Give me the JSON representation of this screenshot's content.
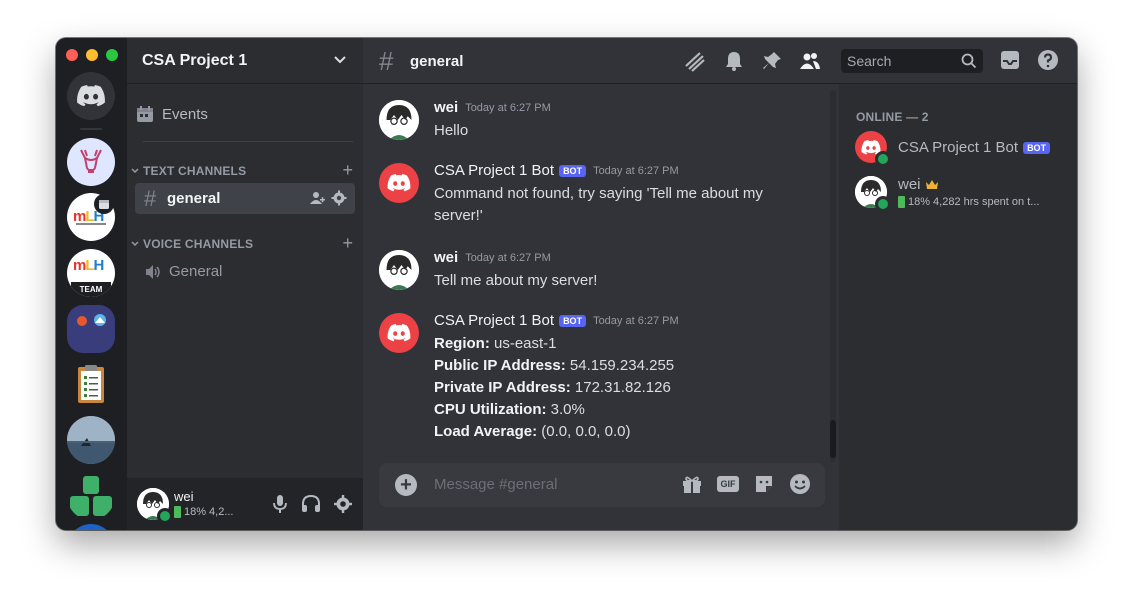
{
  "server": {
    "name": "CSA Project 1"
  },
  "rail": {
    "home_icon": "discord-logo-icon",
    "servers": [
      {
        "name": "deer-server",
        "icon": "deer-icon"
      },
      {
        "name": "mlh-server",
        "text": "MLH"
      },
      {
        "name": "mlh-team-server",
        "text": "MLH",
        "sub": "TEAM"
      },
      {
        "name": "art-server",
        "icon": "art-icon"
      },
      {
        "name": "clipboard-server",
        "icon": "clipboard-icon"
      },
      {
        "name": "photo-server",
        "icon": "photo-icon"
      },
      {
        "name": "green-server",
        "icon": "green-logo-icon"
      }
    ]
  },
  "sidebar": {
    "events_label": "Events",
    "categories": {
      "text": {
        "label": "TEXT CHANNELS"
      },
      "voice": {
        "label": "VOICE CHANNELS"
      }
    },
    "channels": [
      {
        "name": "general",
        "type": "text",
        "active": true
      },
      {
        "name": "General",
        "type": "voice",
        "active": false
      }
    ]
  },
  "user_panel": {
    "name": "wei",
    "status_text": "18%",
    "status_extra": "4,2..."
  },
  "header": {
    "channel": "general",
    "search_placeholder": "Search"
  },
  "messages": [
    {
      "author": "wei",
      "bot": false,
      "time": "Today at 6:27 PM",
      "text": "Hello"
    },
    {
      "author": "CSA Project 1 Bot",
      "bot": true,
      "bot_tag": "BOT",
      "time": "Today at 6:27 PM",
      "text": "Command not found, try saying 'Tell me about my server!'"
    },
    {
      "author": "wei",
      "bot": false,
      "time": "Today at 6:27 PM",
      "text": "Tell me about my server!"
    },
    {
      "author": "CSA Project 1 Bot",
      "bot": true,
      "bot_tag": "BOT",
      "time": "Today at 6:27 PM",
      "fields": [
        {
          "key": "Region:",
          "value": " us-east-1"
        },
        {
          "key": "Public IP Address:",
          "value": " 54.159.234.255"
        },
        {
          "key": "Private IP Address:",
          "value": " 172.31.82.126"
        },
        {
          "key": "CPU Utilization:",
          "value": " 3.0%"
        },
        {
          "key": "Load Average:",
          "value": " (0.0, 0.0, 0.0)"
        }
      ]
    }
  ],
  "composer": {
    "placeholder": "Message #general",
    "gif_label": "GIF"
  },
  "members": {
    "heading": "ONLINE — 2",
    "list": [
      {
        "name": "CSA Project 1 Bot",
        "bot_tag": "BOT",
        "color": "#b5bac1"
      },
      {
        "name": "wei",
        "color": "#b5bac1",
        "crown": "crown-icon",
        "status": "18%",
        "activity": "4,282 hrs spent on t..."
      }
    ]
  },
  "colors": {
    "bg_chat": "#313338",
    "bg_sidebar": "#2b2d31",
    "bg_rail": "#1e1f22",
    "blurple": "#5865f2",
    "bot_red": "#ed4245",
    "online": "#23a55a"
  }
}
